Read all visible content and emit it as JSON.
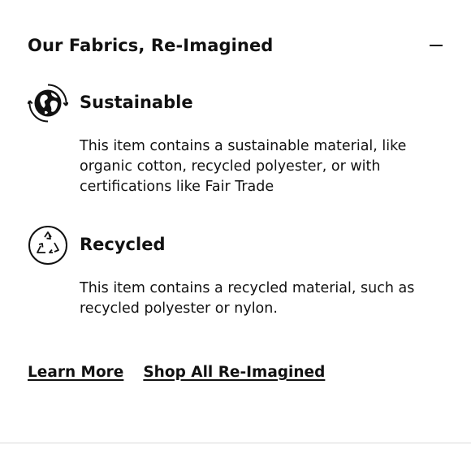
{
  "section": {
    "title": "Our Fabrics, Re-Imagined",
    "collapse_icon": "minus-icon"
  },
  "features": [
    {
      "icon": "globe-cycle-icon",
      "title": "Sustainable",
      "description": "This item contains a sustainable material, like organic cotton, recycled polyester, or with certifications like Fair Trade"
    },
    {
      "icon": "recycle-icon",
      "title": "Recycled",
      "description": "This item contains a recycled material, such as recycled polyester or nylon."
    }
  ],
  "links": {
    "learn_more": "Learn More",
    "shop_all": "Shop All Re-Imagined"
  },
  "colors": {
    "text": "#111111",
    "background": "#ffffff",
    "divider": "#d9d9d9"
  }
}
